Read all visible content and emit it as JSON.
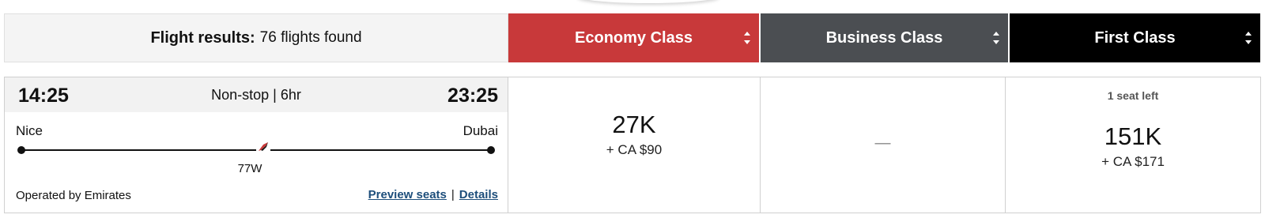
{
  "header": {
    "results_title": "Flight results:",
    "results_count": "76 flights found",
    "classes": [
      {
        "label": "Economy Class",
        "color": "#c8393a"
      },
      {
        "label": "Business Class",
        "color": "#4b4e52"
      },
      {
        "label": "First Class",
        "color": "#000000"
      }
    ]
  },
  "flight": {
    "departure_time": "14:25",
    "arrival_time": "23:25",
    "stops_duration": "Non-stop | 6hr",
    "origin": "Nice",
    "destination": "Dubai",
    "aircraft": "77W",
    "operator": "Operated by Emirates",
    "preview_seats_label": "Preview seats",
    "separator": "|",
    "details_label": "Details",
    "airline_icon": "emirates-plane-icon"
  },
  "fares": {
    "economy": {
      "miles": "27K",
      "tax": "+ CA $90"
    },
    "business": {
      "unavailable": "—"
    },
    "first": {
      "seats_left": "1 seat left",
      "miles": "151K",
      "tax": "+ CA $171"
    }
  }
}
